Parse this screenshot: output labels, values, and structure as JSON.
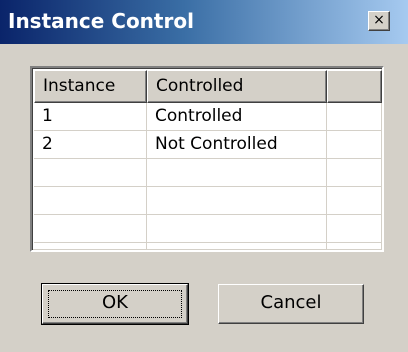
{
  "window": {
    "title": "Instance Control",
    "close_label": "×"
  },
  "table": {
    "columns": [
      "Instance",
      "Controlled",
      ""
    ],
    "rows": [
      [
        "1",
        "Controlled",
        ""
      ],
      [
        "2",
        "Not Controlled",
        ""
      ],
      [
        "",
        "",
        ""
      ],
      [
        "",
        "",
        ""
      ],
      [
        "",
        "",
        ""
      ],
      [
        "",
        "",
        ""
      ]
    ]
  },
  "buttons": {
    "ok_label": "OK",
    "cancel_label": "Cancel"
  },
  "colors": {
    "titlebar_start": "#0a246a",
    "titlebar_end": "#a6caf0",
    "face": "#d4d0c8"
  }
}
